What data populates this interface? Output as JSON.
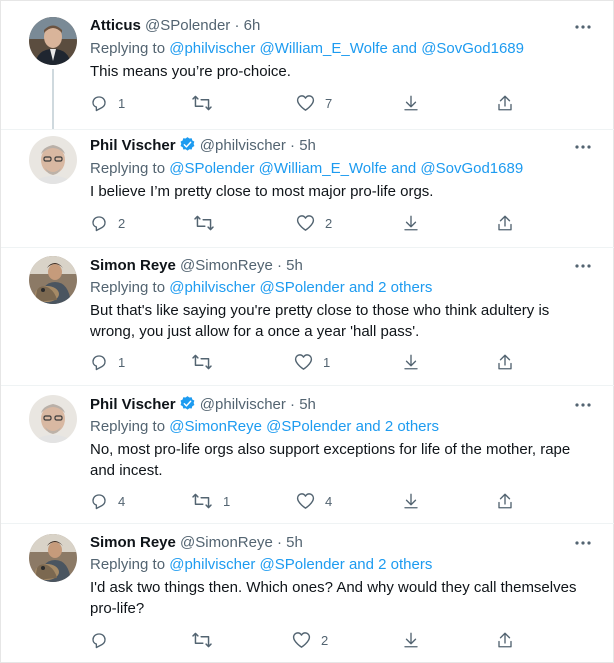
{
  "tweets": [
    {
      "name": "Atticus",
      "handle": "@SPolender",
      "dot": "·",
      "time": "6h",
      "replying_prefix": "Replying to",
      "mention1": "@philvischer",
      "mention2": "@William_E_Wolfe",
      "conj": "and",
      "mention3": "@SovGod1689",
      "text": "This means you’re pro-choice.",
      "replies": "1",
      "retweets": "",
      "likes": "7",
      "icons": [
        "more-icon",
        "reply-icon",
        "retweet-icon",
        "like-icon",
        "bookmark-icon",
        "share-icon"
      ]
    },
    {
      "name": "Phil Vischer",
      "handle": "@philvischer",
      "dot": "·",
      "time": "5h",
      "replying_prefix": "Replying to",
      "mention1": "@SPolender",
      "mention2": "@William_E_Wolfe",
      "conj": "and",
      "mention3": "@SovGod1689",
      "text": "I believe I’m pretty close to most major pro-life orgs.",
      "replies": "2",
      "retweets": "",
      "likes": "2",
      "verified": true
    },
    {
      "name": "Simon Reye",
      "handle": "@SimonReye",
      "dot": "·",
      "time": "5h",
      "replying_prefix": "Replying to",
      "mention1": "@philvischer",
      "mention2": "@SPolender",
      "conj": "and",
      "mention3": "2 others",
      "text": "But that's like saying you're pretty close to those who think adultery is wrong, you just allow for a once a year 'hall pass'.",
      "replies": "1",
      "retweets": "",
      "likes": "1"
    },
    {
      "name": "Phil Vischer",
      "handle": "@philvischer",
      "dot": "·",
      "time": "5h",
      "replying_prefix": "Replying to",
      "mention1": "@SimonReye",
      "mention2": "@SPolender",
      "conj": "and",
      "mention3": "2 others",
      "text": "No, most pro-life orgs also support exceptions for life of the mother, rape and incest.",
      "replies": "4",
      "retweets": "1",
      "likes": "4",
      "verified": true
    },
    {
      "name": "Simon Reye",
      "handle": "@SimonReye",
      "dot": "·",
      "time": "5h",
      "replying_prefix": "Replying to",
      "mention1": "@philvischer",
      "mention2": "@SPolender",
      "conj": "and",
      "mention3": "2 others",
      "text": "I'd ask two things then. Which ones? And why would they call themselves pro-life?",
      "replies": "",
      "retweets": "",
      "likes": "2"
    }
  ],
  "colors": {
    "link": "#1d9bf0",
    "secondary": "#536471",
    "verified": "#1d9bf0",
    "thread_line": "#cfd9de"
  }
}
